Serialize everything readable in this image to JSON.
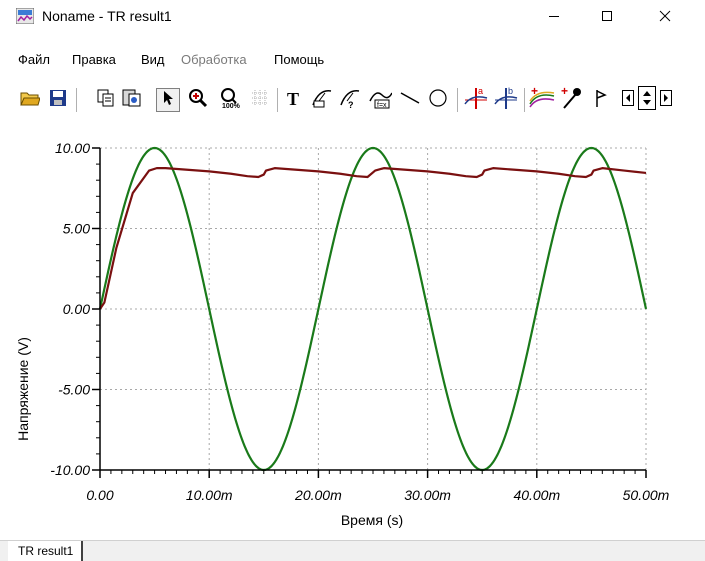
{
  "window": {
    "title": "Noname - TR result1",
    "minimize_icon": "minimize-icon",
    "maximize_icon": "maximize-icon",
    "close_icon": "close-icon"
  },
  "menu": {
    "items": [
      {
        "label": "Файл",
        "enabled": true
      },
      {
        "label": "Правка",
        "enabled": true
      },
      {
        "label": "Вид",
        "enabled": true
      },
      {
        "label": "Обработка",
        "enabled": false
      },
      {
        "label": "Помощь",
        "enabled": true
      }
    ]
  },
  "toolbar": {
    "buttons": [
      {
        "icon": "open-folder-icon"
      },
      {
        "icon": "save-icon"
      },
      {
        "icon": "copy-icon"
      },
      {
        "icon": "copy-to-clipboard-icon"
      },
      {
        "icon": "pointer-icon",
        "pressed": true
      },
      {
        "icon": "zoom-in-icon"
      },
      {
        "icon": "zoom-100-icon"
      },
      {
        "icon": "grid-icon"
      },
      {
        "icon": "text-tool-icon"
      },
      {
        "icon": "curve-label-icon"
      },
      {
        "icon": "curve-info-icon"
      },
      {
        "icon": "curve-function-icon"
      },
      {
        "icon": "line-tool-icon"
      },
      {
        "icon": "ellipse-tool-icon"
      },
      {
        "icon": "cursor-a-icon"
      },
      {
        "icon": "cursor-b-icon"
      },
      {
        "icon": "add-curve-icon"
      },
      {
        "icon": "color-picker-icon"
      },
      {
        "icon": "flag-icon"
      },
      {
        "icon": "scroll-left-icon"
      },
      {
        "icon": "scroll-updown-icon"
      },
      {
        "icon": "scroll-right-icon"
      }
    ]
  },
  "chart_data": {
    "type": "line",
    "title": "",
    "xlabel": "Время (s)",
    "ylabel": "Напряжение (V)",
    "xlim": [
      0,
      0.05
    ],
    "ylim": [
      -10,
      10
    ],
    "grid": true,
    "x_ticks": [
      0,
      0.01,
      0.02,
      0.03,
      0.04,
      0.05
    ],
    "x_tick_labels": [
      "0.00",
      "10.00m",
      "20.00m",
      "30.00m",
      "40.00m",
      "50.00m"
    ],
    "y_ticks": [
      10,
      5,
      0,
      -5,
      -10
    ],
    "y_tick_labels": [
      "10.00",
      "5.00",
      "0.00",
      "-5.00",
      "-10.00"
    ],
    "series": [
      {
        "color": "#1a7a1a",
        "kind": "sine",
        "amplitude": 10,
        "frequency_hz": 50,
        "x": [
          0,
          0.0025,
          0.005,
          0.0075,
          0.01,
          0.0125,
          0.015,
          0.0175,
          0.02,
          0.0225,
          0.025,
          0.0275,
          0.03,
          0.0325,
          0.035,
          0.0375,
          0.04,
          0.0425,
          0.045,
          0.0475,
          0.05
        ],
        "y": [
          0,
          7.07,
          10,
          7.07,
          0,
          -7.07,
          -10,
          -7.07,
          0,
          7.07,
          10,
          7.07,
          0,
          -7.07,
          -10,
          -7.07,
          0,
          7.07,
          10,
          7.07,
          0
        ]
      },
      {
        "color": "#7a1010",
        "kind": "rectified",
        "x": [
          0,
          0.0004,
          0.0015,
          0.003,
          0.0045,
          0.0052,
          0.006,
          0.008,
          0.01,
          0.012,
          0.0135,
          0.0145,
          0.015,
          0.0152,
          0.016,
          0.018,
          0.02,
          0.022,
          0.0235,
          0.0245,
          0.0252,
          0.026,
          0.028,
          0.03,
          0.032,
          0.0335,
          0.0345,
          0.035,
          0.0352,
          0.036,
          0.038,
          0.04,
          0.042,
          0.0435,
          0.0445,
          0.045,
          0.0452,
          0.046,
          0.048,
          0.05
        ],
        "y": [
          0,
          0.4,
          3.8,
          7.2,
          8.6,
          8.75,
          8.75,
          8.65,
          8.55,
          8.4,
          8.25,
          8.2,
          8.35,
          8.6,
          8.75,
          8.65,
          8.55,
          8.4,
          8.25,
          8.2,
          8.6,
          8.75,
          8.65,
          8.55,
          8.4,
          8.25,
          8.2,
          8.35,
          8.6,
          8.75,
          8.65,
          8.55,
          8.4,
          8.25,
          8.2,
          8.35,
          8.6,
          8.75,
          8.6,
          8.45
        ]
      }
    ]
  },
  "tabs": [
    {
      "label": "TR result1"
    }
  ]
}
